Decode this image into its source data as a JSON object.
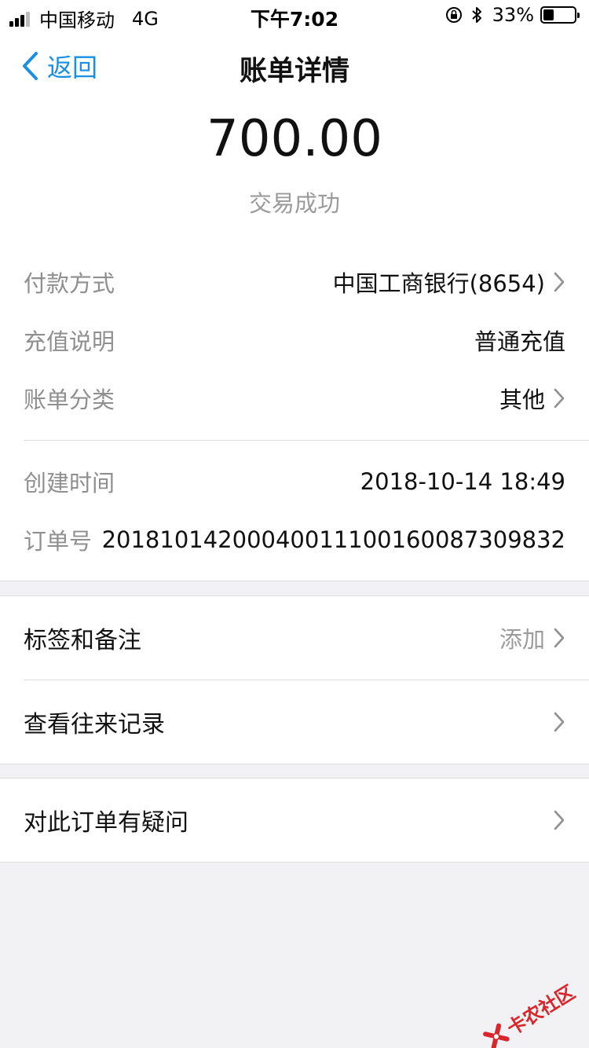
{
  "status_bar": {
    "carrier": "中国移动",
    "network": "4G",
    "time": "下午7:02",
    "battery_percent": "33%",
    "battery_level": 0.33
  },
  "nav": {
    "back_label": "返回",
    "title": "账单详情"
  },
  "summary": {
    "amount": "700.00",
    "status": "交易成功"
  },
  "details": {
    "payment_method_label": "付款方式",
    "payment_method_value": "中国工商银行(8654)",
    "recharge_desc_label": "充值说明",
    "recharge_desc_value": "普通充值",
    "category_label": "账单分类",
    "category_value": "其他",
    "created_time_label": "创建时间",
    "created_time_value": "2018-10-14 18:49",
    "order_no_label": "订单号",
    "order_no_value": "20181014200040011100160087309832"
  },
  "actions": {
    "tags_label": "标签和备注",
    "tags_value": "添加",
    "history_label": "查看往来记录",
    "question_label": "对此订单有疑问"
  },
  "watermark": {
    "text": "卡农社区"
  },
  "colors": {
    "accent": "#1a8fe3",
    "background": "#f2f2f4",
    "muted_text": "#8f8f8f",
    "watermark": "#d9262c"
  }
}
